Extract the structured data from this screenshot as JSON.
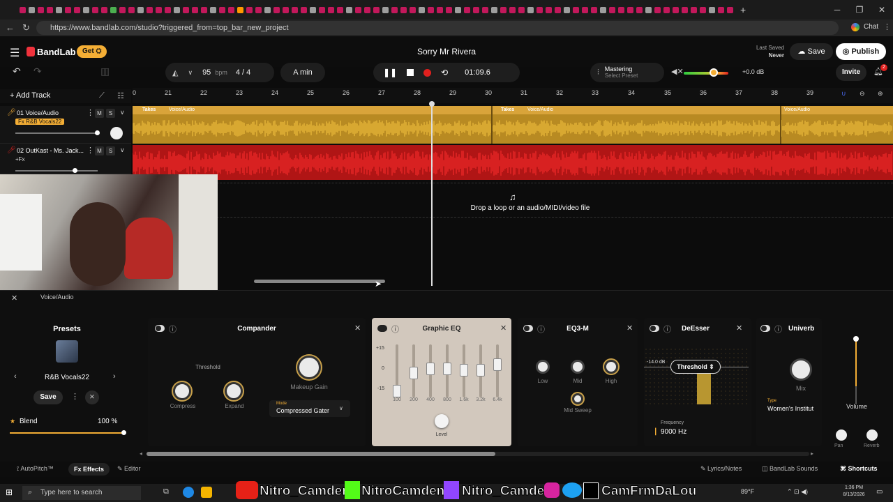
{
  "browser": {
    "url": "https://www.bandlab.com/studio?triggered_from=top_bar_new_project",
    "profile_label": "Chat"
  },
  "app": {
    "brand": "BandLab",
    "get_label": "Get",
    "project_title": "Sorry Mr Rivera",
    "last_saved_label": "Last Saved",
    "last_saved_value": "Never",
    "save_label": "Save",
    "publish_label": "Publish",
    "invite_label": "Invite",
    "notif_count": "2"
  },
  "transport": {
    "bpm": "95",
    "bpm_unit": "bpm",
    "time_sig": "4 / 4",
    "key": "A min",
    "time": "01:09.6",
    "mastering_label": "Mastering",
    "mastering_sub": "Select Preset",
    "volume_db": "+0.0 dB"
  },
  "tracks_header": {
    "add_track": "Add Track"
  },
  "ruler": [
    "0",
    "21",
    "22",
    "23",
    "24",
    "25",
    "26",
    "27",
    "28",
    "29",
    "30",
    "31",
    "32",
    "33",
    "34",
    "35",
    "36",
    "37",
    "38",
    "39"
  ],
  "tracks": [
    {
      "name": "01  Voice/Audio",
      "fx": "Fx R&B Vocals22",
      "m": "M",
      "s": "S"
    },
    {
      "name": "02  OutKast - Ms. Jack...",
      "fx": "+Fx",
      "m": "M",
      "s": "S"
    }
  ],
  "clips": {
    "takes": "Takes",
    "voice": "Voice/Audio"
  },
  "drop_text": "Drop a loop or an audio/MIDI/video file",
  "panel_title": "Voice/Audio",
  "presets": {
    "title": "Presets",
    "name": "R&B Vocals22",
    "save": "Save",
    "blend_label": "Blend",
    "blend_value": "100 %"
  },
  "compander": {
    "title": "Compander",
    "threshold": "Threshold",
    "compress": "Compress",
    "expand": "Expand",
    "makeup": "Makeup Gain",
    "mode_label": "Mode",
    "mode_value": "Compressed Gater"
  },
  "geq": {
    "title": "Graphic EQ",
    "scale": [
      "+15",
      "0",
      "-15"
    ],
    "bands": [
      "100",
      "200",
      "400",
      "800",
      "1.6k",
      "3.2k",
      "6.4k"
    ],
    "level": "Level"
  },
  "eq3": {
    "title": "EQ3-M",
    "low": "Low",
    "mid": "Mid",
    "high": "High",
    "sweep": "Mid Sweep"
  },
  "deesser": {
    "title": "DeEsser",
    "db": "-14.0 dB",
    "threshold": "Threshold",
    "freq_label": "Frequency",
    "freq_value": "9000 Hz"
  },
  "univerb": {
    "title": "Univerb",
    "mix": "Mix",
    "type_label": "Type",
    "type_value": "Women's Institut"
  },
  "right_panel": {
    "volume": "Volume",
    "pan": "Pan",
    "reverb": "Reverb"
  },
  "footer": {
    "autopitch": "AutoPitch™",
    "effects": "Effects",
    "editor": "Editor",
    "lyrics": "Lyrics/Notes",
    "sounds": "BandLab Sounds",
    "shortcuts": "Shortcuts"
  },
  "taskbar": {
    "search": "Type here to search",
    "overlay1": "Nitro_Camden",
    "overlay2": "NitroCamden",
    "overlay3": "Nitro_Camden",
    "overlay4": "CamFrmDaLou",
    "temp": "89°F",
    "time": "1:36 PM",
    "date": "8/13/2026"
  },
  "colors": {
    "accent_orange": "#f4ae35",
    "track_red": "#e0201e",
    "brand_red": "#f0323c"
  }
}
